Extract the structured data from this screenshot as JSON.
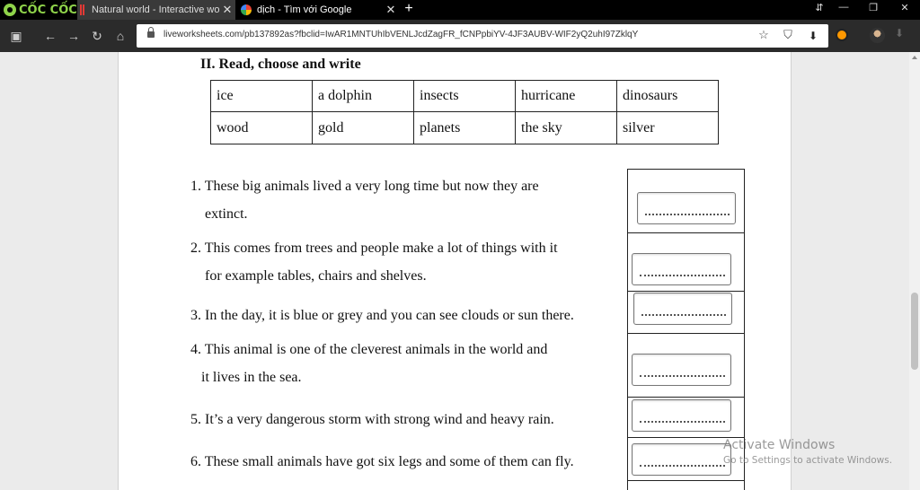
{
  "browser": {
    "logo_text": "CỐC CỐC",
    "tabs": [
      {
        "title": "Natural world - Interactive wo",
        "close": "✕"
      },
      {
        "title": "dịch - Tìm với Google",
        "close": "✕"
      }
    ],
    "new_tab": "+",
    "url": "liveworksheets.com/pb137892as?fbclid=IwAR1MNTUhIbVENLJcdZagFR_fCNPpbiYV-4JF3AUBV-WIF2yQ2uhI97ZklqY",
    "window_controls": [
      "⇵",
      "—",
      "❐",
      "✕"
    ],
    "icons": {
      "sidebar": "▣",
      "back": "←",
      "forward": "→",
      "reload": "↻",
      "home": "⌂",
      "bookmark": "☆",
      "shield": "⛉",
      "download": "⬇",
      "tb_down": "⬇"
    }
  },
  "worksheet": {
    "heading": "II. Read, choose and write",
    "word_table": [
      [
        "ice",
        "a dolphin",
        "insects",
        "hurricane",
        "dinosaurs"
      ],
      [
        "wood",
        "gold",
        "planets",
        "the sky",
        "silver"
      ]
    ],
    "questions": [
      {
        "lines": [
          "1. These big animals lived a very long time but now they are",
          "    extinct."
        ],
        "answer": ""
      },
      {
        "lines": [
          "2. This comes from trees and people make a lot of things with it",
          "    for example tables, chairs and shelves."
        ],
        "answer": ""
      },
      {
        "lines": [
          "3. In the day, it is blue or grey and you can see clouds or sun there."
        ],
        "answer": ""
      },
      {
        "lines": [
          "4. This animal is one of the cleverest animals in the world and",
          "   it lives in the sea."
        ],
        "answer": ""
      },
      {
        "lines": [
          "5. It’s a very dangerous storm with strong wind and heavy rain."
        ],
        "answer": ""
      },
      {
        "lines": [
          "6. These small animals have got six legs and some of them can fly."
        ],
        "answer": ""
      }
    ]
  },
  "watermark": {
    "title": "Activate Windows",
    "subtitle": "Go to Settings to activate Windows."
  }
}
